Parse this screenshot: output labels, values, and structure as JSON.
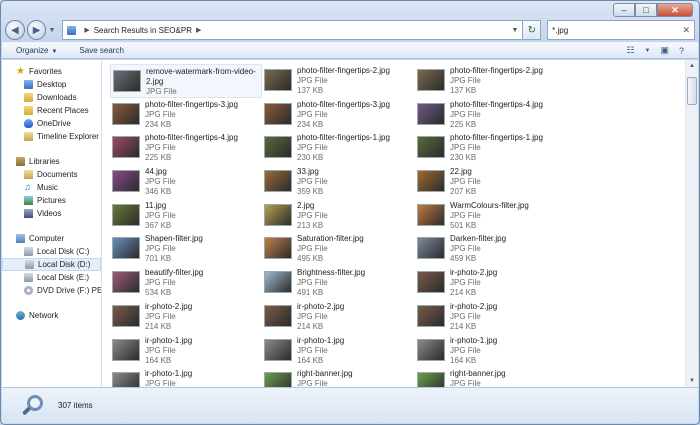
{
  "window": {
    "controls": {
      "minimize": "‒",
      "maximize": "□",
      "close": "✕"
    }
  },
  "address": {
    "path": "Search Results in SEO&PR"
  },
  "search": {
    "value": "*.jpg"
  },
  "toolbar": {
    "organize": "Organize",
    "save_search": "Save search"
  },
  "navigation": {
    "favorites": {
      "label": "Favorites",
      "items": [
        "Desktop",
        "Downloads",
        "Recent Places",
        "OneDrive",
        "Timeline Explorer"
      ]
    },
    "libraries": {
      "label": "Libraries",
      "items": [
        "Documents",
        "Music",
        "Pictures",
        "Videos"
      ]
    },
    "computer": {
      "label": "Computer",
      "items": [
        "Local Disk (C:)",
        "Local Disk (D:)",
        "Local Disk (E:)",
        "DVD Drive (F:) PETER"
      ],
      "selected": "Local Disk (D:)"
    },
    "network": {
      "label": "Network"
    }
  },
  "files": [
    {
      "name": "remove-watermark-from-video-2.jpg",
      "type": "JPG File",
      "size": "",
      "thumb": "#6b6f76"
    },
    {
      "name": "photo-filter-fingertips-2.jpg",
      "type": "JPG File",
      "size": "137 KB",
      "thumb": "#7d6a4f"
    },
    {
      "name": "photo-filter-fingertips-2.jpg",
      "type": "JPG File",
      "size": "137 KB",
      "thumb": "#7d6a4f"
    },
    {
      "name": "photo-filter-fingertips-3.jpg",
      "type": "JPG File",
      "size": "234 KB",
      "thumb": "#8a5a3a"
    },
    {
      "name": "photo-filter-fingertips-3.jpg",
      "type": "JPG File",
      "size": "234 KB",
      "thumb": "#8a5a3a"
    },
    {
      "name": "photo-filter-fingertips-4.jpg",
      "type": "JPG File",
      "size": "225 KB",
      "thumb": "#6f5a8a"
    },
    {
      "name": "photo-filter-fingertips-4.jpg",
      "type": "JPG File",
      "size": "225 KB",
      "thumb": "#a04a6a"
    },
    {
      "name": "photo-filter-fingertips-1.jpg",
      "type": "JPG File",
      "size": "230 KB",
      "thumb": "#5a6a3a"
    },
    {
      "name": "photo-filter-fingertips-1.jpg",
      "type": "JPG File",
      "size": "230 KB",
      "thumb": "#5a6a3a"
    },
    {
      "name": "44.jpg",
      "type": "JPG File",
      "size": "346 KB",
      "thumb": "#8a4a8a"
    },
    {
      "name": "33.jpg",
      "type": "JPG File",
      "size": "359 KB",
      "thumb": "#9a6a3a"
    },
    {
      "name": "22.jpg",
      "type": "JPG File",
      "size": "207 KB",
      "thumb": "#a06a30"
    },
    {
      "name": "11.jpg",
      "type": "JPG File",
      "size": "367 KB",
      "thumb": "#6a7a3a"
    },
    {
      "name": "2.jpg",
      "type": "JPG File",
      "size": "213 KB",
      "thumb": "#b8a050"
    },
    {
      "name": "WarmColours-filter.jpg",
      "type": "JPG File",
      "size": "501 KB",
      "thumb": "#c07a40"
    },
    {
      "name": "Shapen-filter.jpg",
      "type": "JPG File",
      "size": "701 KB",
      "thumb": "#6a90b8"
    },
    {
      "name": "Saturation-filter.jpg",
      "type": "JPG File",
      "size": "495 KB",
      "thumb": "#c0804a"
    },
    {
      "name": "Darken-filter.jpg",
      "type": "JPG File",
      "size": "459 KB",
      "thumb": "#7a8aa0"
    },
    {
      "name": "beautify-filter.jpg",
      "type": "JPG File",
      "size": "534 KB",
      "thumb": "#a05a7a"
    },
    {
      "name": "Brightness-filter.jpg",
      "type": "JPG File",
      "size": "491 KB",
      "thumb": "#a0b8d0"
    },
    {
      "name": "ir-photo-2.jpg",
      "type": "JPG File",
      "size": "214 KB",
      "thumb": "#7a5a4a"
    },
    {
      "name": "ir-photo-2.jpg",
      "type": "JPG File",
      "size": "214 KB",
      "thumb": "#7a5a4a"
    },
    {
      "name": "ir-photo-2.jpg",
      "type": "JPG File",
      "size": "214 KB",
      "thumb": "#7a5a4a"
    },
    {
      "name": "ir-photo-2.jpg",
      "type": "JPG File",
      "size": "214 KB",
      "thumb": "#7a5a4a"
    },
    {
      "name": "ir-photo-1.jpg",
      "type": "JPG File",
      "size": "164 KB",
      "thumb": "#8a8a8a"
    },
    {
      "name": "ir-photo-1.jpg",
      "type": "JPG File",
      "size": "164 KB",
      "thumb": "#8a8a8a"
    },
    {
      "name": "ir-photo-1.jpg",
      "type": "JPG File",
      "size": "164 KB",
      "thumb": "#8a8a8a"
    },
    {
      "name": "ir-photo-1.jpg",
      "type": "JPG File",
      "size": "164 KB",
      "thumb": "#8a8a8a"
    },
    {
      "name": "right-banner.jpg",
      "type": "JPG File",
      "size": "",
      "thumb": "#6aa04a"
    },
    {
      "name": "right-banner.jpg",
      "type": "JPG File",
      "size": "",
      "thumb": "#6aa04a"
    }
  ],
  "status": {
    "count": "307 items"
  }
}
